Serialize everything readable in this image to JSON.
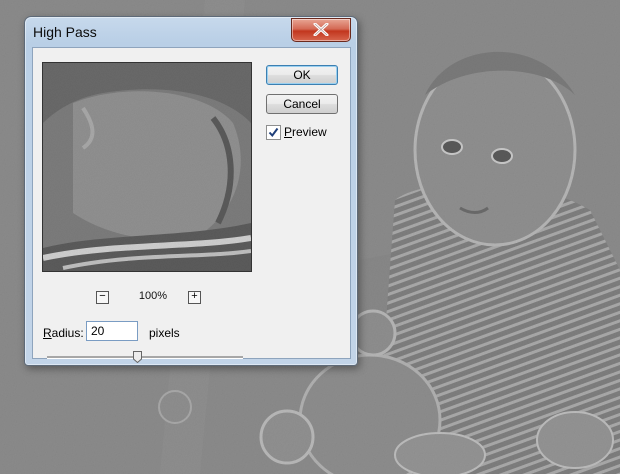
{
  "dialog": {
    "title": "High Pass",
    "ok_label": "OK",
    "cancel_label": "Cancel",
    "preview_label": "Preview",
    "preview_checked": true,
    "zoom_out": "−",
    "zoom_in": "+",
    "zoom_level": "100%",
    "radius_label": "Radius:",
    "radius_value": "20",
    "unit_label": "pixels",
    "slider_fraction": 0.46
  },
  "icons": {
    "close": "close-icon",
    "checkmark": "checkmark-icon",
    "slider_thumb": "slider-thumb-icon"
  },
  "colors": {
    "canvas_gray": "#8a8a8a",
    "dialog_frame": "#b9cfe6",
    "close_red": "#c2361e",
    "client_bg": "#f0f0f0"
  }
}
